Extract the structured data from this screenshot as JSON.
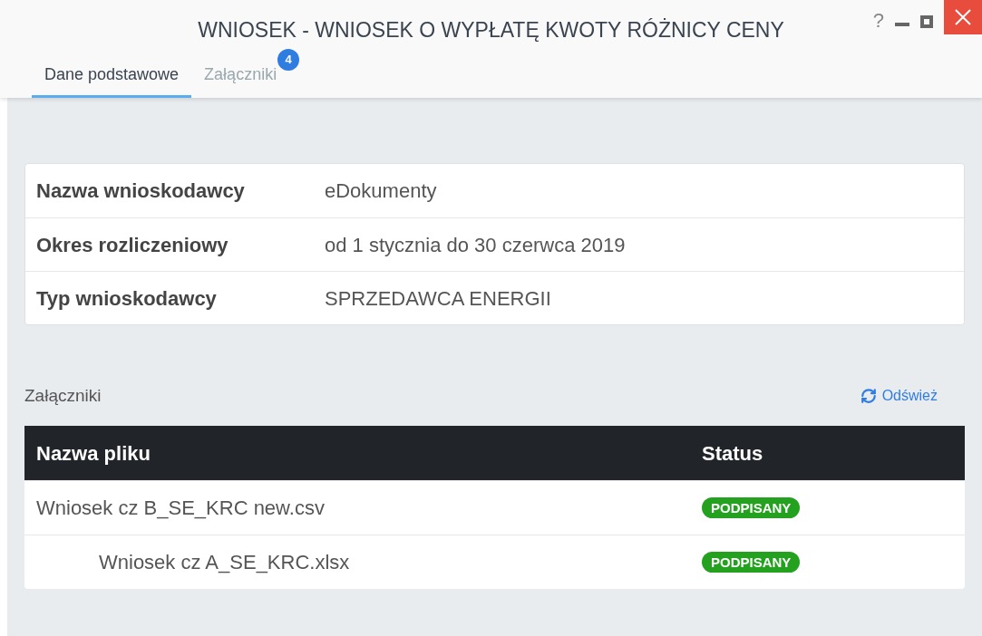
{
  "window": {
    "title": "WNIOSEK - WNIOSEK O WYPŁATĘ KWOTY RÓŻNICY CENY",
    "help": "?"
  },
  "tabs": [
    {
      "label": "Dane podstawowe",
      "selected": true
    },
    {
      "label": "Załączniki",
      "selected": false,
      "badge": "4"
    }
  ],
  "details": [
    {
      "label": "Nazwa wnioskodawcy",
      "value": "eDokumenty"
    },
    {
      "label": "Okres rozliczeniowy",
      "value": "od 1 stycznia do 30 czerwca 2019"
    },
    {
      "label": "Typ wnioskodawcy",
      "value": "SPRZEDAWCA ENERGII"
    }
  ],
  "attachments": {
    "title": "Załączniki",
    "refresh": "Odśwież",
    "table": {
      "columns": [
        "Nazwa pliku",
        "Status"
      ],
      "rows": [
        {
          "name": "Wniosek cz B_SE_KRC new.csv",
          "status": "PODPISANY",
          "children": [
            {
              "name": "Wniosek cz A_SE_KRC.xlsx",
              "status": "PODPISANY"
            }
          ]
        }
      ]
    }
  }
}
